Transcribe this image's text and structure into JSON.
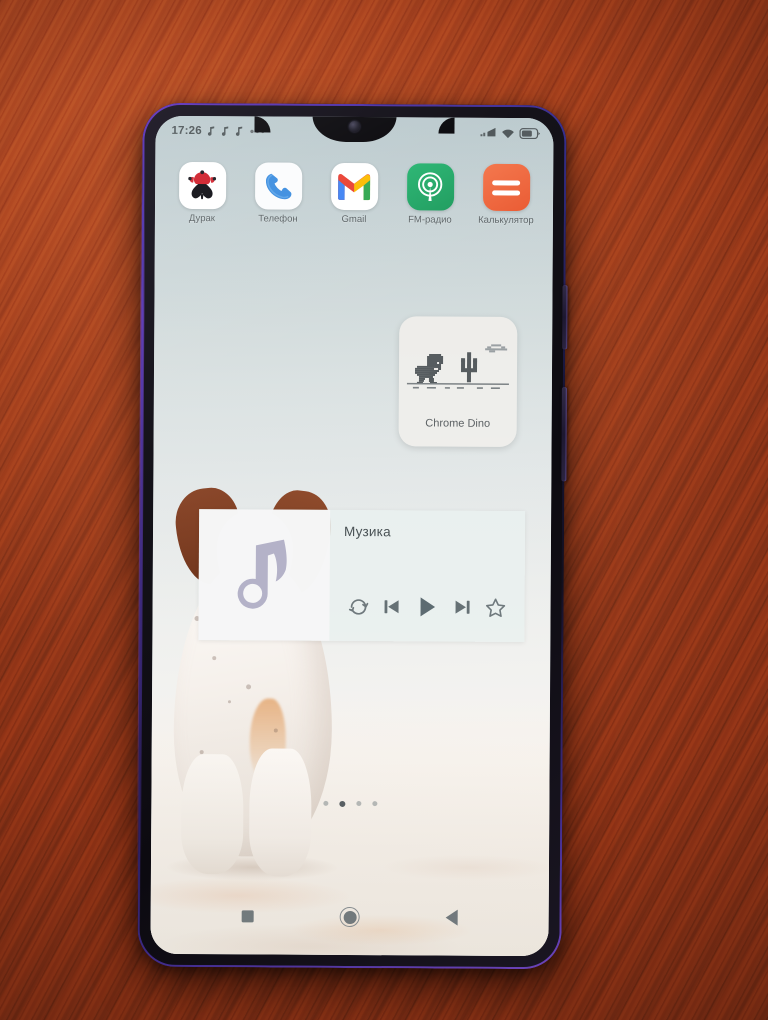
{
  "scene": {
    "description": "Photo of a smartphone on a wooden table showing an Android home screen",
    "table_color": "#a4421f",
    "phone_frame_color": "#15131a",
    "phone_edge_accent": "#7c4ce1"
  },
  "status_bar": {
    "time": "17:26",
    "left_icons": [
      "music-note-icon",
      "music-note-icon",
      "music-note-icon"
    ],
    "more_indicator": "•••",
    "right_icons": [
      "signal-bars-icon",
      "wifi-icon",
      "battery-icon"
    ],
    "text_color": "#4b5356"
  },
  "apps": [
    {
      "label": "Дурак",
      "icon": "playing-card-jester-icon",
      "bg": "#ffffff"
    },
    {
      "label": "Телефон",
      "icon": "phone-handset-icon",
      "bg": "#fbfcfd"
    },
    {
      "label": "Gmail",
      "icon": "gmail-m-icon",
      "bg": "#ffffff"
    },
    {
      "label": "FM-радио",
      "icon": "radio-broadcast-icon",
      "bg": "#22a565"
    },
    {
      "label": "Калькулятор",
      "icon": "equals-sign-icon",
      "bg": "#f0663c"
    }
  ],
  "dino_widget": {
    "label": "Chrome Dino",
    "background": "#efeeeb",
    "art_color": "#555b5e",
    "elements": [
      "trex-dino",
      "cactus",
      "cloud",
      "ground-line"
    ]
  },
  "music_widget": {
    "title": "Музика",
    "album_art_icon": "music-note-placeholder-icon",
    "background": "#e9f0ef",
    "controls": [
      {
        "name": "repeat",
        "icon": "repeat-icon"
      },
      {
        "name": "previous",
        "icon": "skip-previous-icon"
      },
      {
        "name": "play",
        "icon": "play-icon"
      },
      {
        "name": "next",
        "icon": "skip-next-icon"
      },
      {
        "name": "favorite",
        "icon": "star-outline-icon"
      }
    ]
  },
  "page_indicator": {
    "count": 4,
    "active_index": 1
  },
  "nav_bar": {
    "buttons": [
      {
        "name": "recents",
        "icon": "square-icon"
      },
      {
        "name": "home",
        "icon": "circle-icon"
      },
      {
        "name": "back",
        "icon": "triangle-left-icon"
      }
    ]
  },
  "wallpaper": {
    "subject": "white dog with brown ears sitting in snow",
    "sky_color": "#dae2e2",
    "snow_color": "#f7f2ec"
  }
}
